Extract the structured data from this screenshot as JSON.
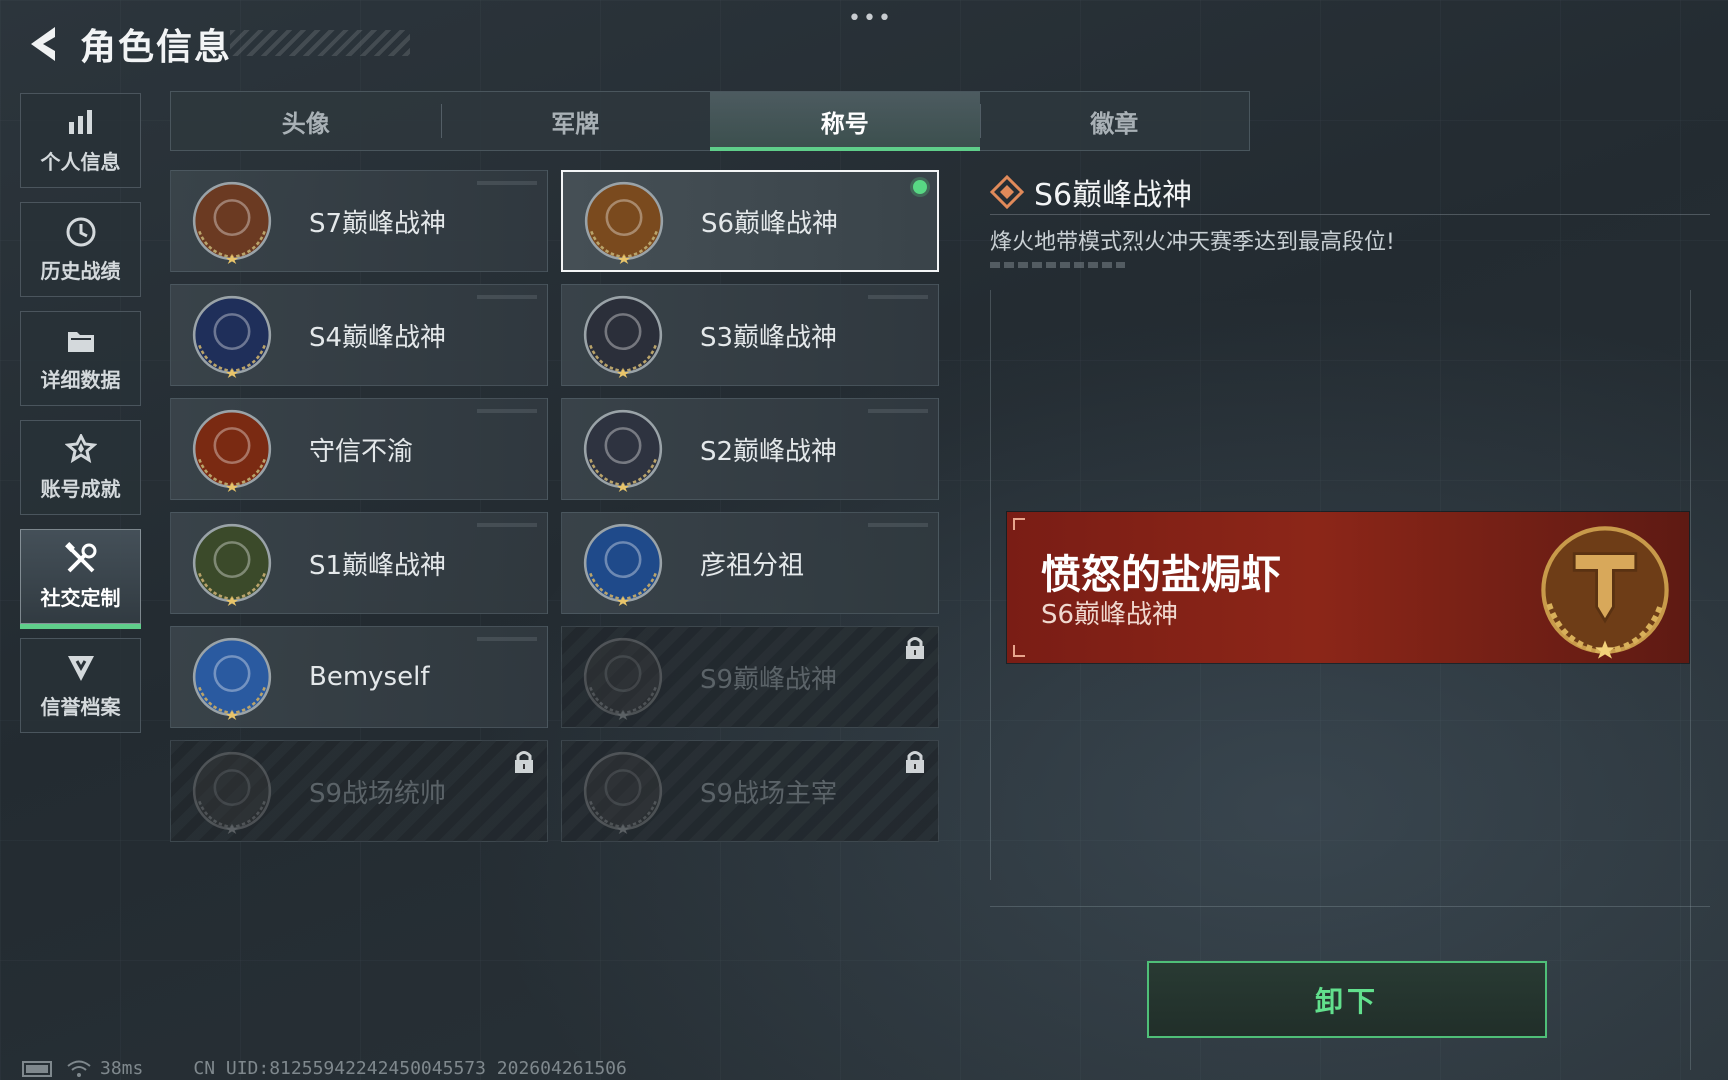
{
  "header": {
    "title": "角色信息"
  },
  "sidebar": {
    "items": [
      {
        "label": "个人信息",
        "icon": "bar-chart-icon",
        "active": false
      },
      {
        "label": "历史战绩",
        "icon": "clock-icon",
        "active": false
      },
      {
        "label": "详细数据",
        "icon": "folder-icon",
        "active": false
      },
      {
        "label": "账号成就",
        "icon": "achievement-icon",
        "active": false
      },
      {
        "label": "社交定制",
        "icon": "tools-icon",
        "active": true
      },
      {
        "label": "信誉档案",
        "icon": "shield-icon",
        "active": false
      }
    ]
  },
  "tabs": [
    {
      "label": "头像",
      "active": false
    },
    {
      "label": "军牌",
      "active": false
    },
    {
      "label": "称号",
      "active": true
    },
    {
      "label": "徽章",
      "active": false
    }
  ],
  "titles": [
    {
      "name": "S7巅峰战神",
      "medal": "crossbow-medal-icon",
      "color": "#6b3a22",
      "state": "normal"
    },
    {
      "name": "S6巅峰战神",
      "medal": "t-emblem-medal-icon",
      "color": "#7a4a1e",
      "state": "selected"
    },
    {
      "name": "S4巅峰战神",
      "medal": "helmet-medal-icon",
      "color": "#1f2f5a",
      "state": "normal"
    },
    {
      "name": "S3巅峰战神",
      "medal": "globe-medal-icon",
      "color": "#2b2f3a",
      "state": "normal"
    },
    {
      "name": "守信不渝",
      "medal": "scales-medal-icon",
      "color": "#7a2a12",
      "state": "normal"
    },
    {
      "name": "S2巅峰战神",
      "medal": "triangle-medal-icon",
      "color": "#2e3340",
      "state": "normal"
    },
    {
      "name": "S1巅峰战神",
      "medal": "crocodile-medal-icon",
      "color": "#3b4a2a",
      "state": "normal"
    },
    {
      "name": "彦祖分祖",
      "medal": "portrait-medal-icon",
      "color": "#1f4a8a",
      "state": "normal"
    },
    {
      "name": "Bemyself",
      "medal": "mech-medal-icon",
      "color": "#2a5aa0",
      "state": "normal"
    },
    {
      "name": "S9巅峰战神",
      "medal": "building-medal-icon",
      "color": "#3a3a3a",
      "state": "locked"
    },
    {
      "name": "S9战场统帅",
      "medal": "warship-medal-icon",
      "color": "#3a3a3a",
      "state": "locked"
    },
    {
      "name": "S9战场主宰",
      "medal": "mushroom-cloud-medal-icon",
      "color": "#3a3a3a",
      "state": "locked"
    }
  ],
  "detail": {
    "title": "S6巅峰战神",
    "description": "烽火地带模式烈火冲天赛季达到最高段位!",
    "preview_name": "愤怒的盐焗虾",
    "preview_title": "S6巅峰战神"
  },
  "actions": {
    "unequip_label": "卸下"
  },
  "status": {
    "ping": "38ms",
    "uid": "CN UID:8125594224245004557​3 202604261506"
  },
  "colors": {
    "accent_green": "#5fce8a",
    "preview_red": "#8c2618",
    "gold": "#c89a4a"
  }
}
